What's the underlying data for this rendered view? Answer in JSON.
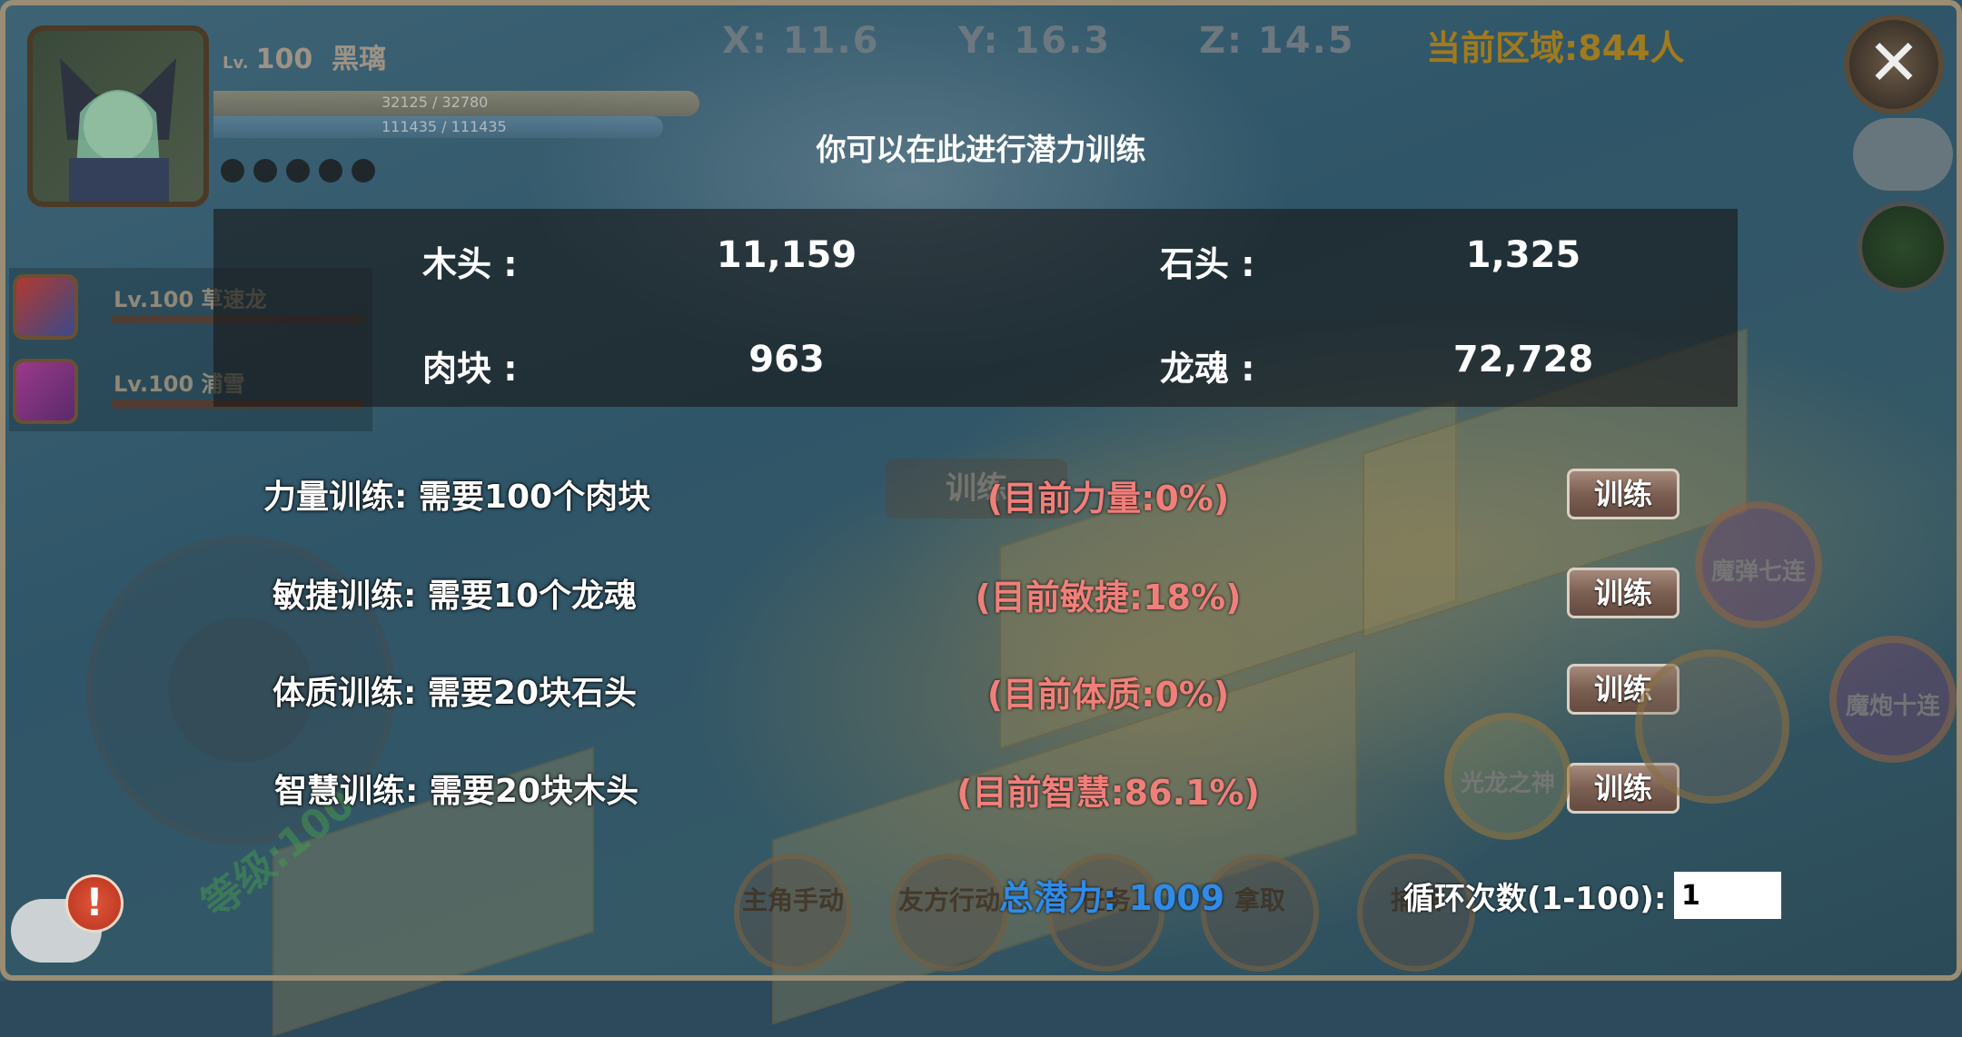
{
  "hud": {
    "level_prefix": "Lv.",
    "level": "100",
    "name": "黑璃",
    "hp_text": "32125 / 32780",
    "mp_text": "111435 / 111435",
    "coord_x": "X: 11.6",
    "coord_y": "Y: 16.3",
    "coord_z": "Z: 14.5",
    "region": "当前区域:844人",
    "hp_fraction": 0.98,
    "mp_fraction": 1.0
  },
  "party": [
    {
      "label": "Lv.100 草速龙"
    },
    {
      "label": "Lv.100 浦雪"
    }
  ],
  "dialog": {
    "title": "你可以在此进行潜力训练",
    "resources": {
      "wood_label": "木头 :",
      "wood_value": "11,159",
      "stone_label": "石头 :",
      "stone_value": "1,325",
      "meat_label": "肉块 :",
      "meat_value": "963",
      "soul_label": "龙魂 :",
      "soul_value": "72,728"
    },
    "trainings": [
      {
        "requirement": "力量训练: 需要100个肉块",
        "current": "(目前力量:0%)",
        "button": "训练"
      },
      {
        "requirement": "敏捷训练: 需要10个龙魂",
        "current": "(目前敏捷:18%)",
        "button": "训练"
      },
      {
        "requirement": "体质训练: 需要20块石头",
        "current": "(目前体质:0%)",
        "button": "训练"
      },
      {
        "requirement": "智慧训练: 需要20块木头",
        "current": "(目前智慧:86.1%)",
        "button": "训练"
      }
    ],
    "total_potential": "总潜力: 1009",
    "loop_label": "循环次数(1-100):",
    "loop_value": "1"
  },
  "bottom_buttons": {
    "main_manual": "主角手动",
    "ally_action": "友方行动",
    "task_off": "任务",
    "pickup": "拿取",
    "capture": "捕获"
  },
  "skills": {
    "skill1": "魔弹七连",
    "skill2": "魔炮十连",
    "skill3": "光龙之神"
  },
  "background_text": {
    "level_tag": "等级:100",
    "train_hint": "训练"
  },
  "colors": {
    "current_stat": "#f07f7a",
    "total_potential": "#2f8be8",
    "region": "#a07a1e"
  },
  "icons": {
    "close": "close-icon",
    "settings": "gear-icon",
    "weather": "cloud-icon",
    "chat": "chat-icon",
    "alert": "exclamation-icon"
  }
}
